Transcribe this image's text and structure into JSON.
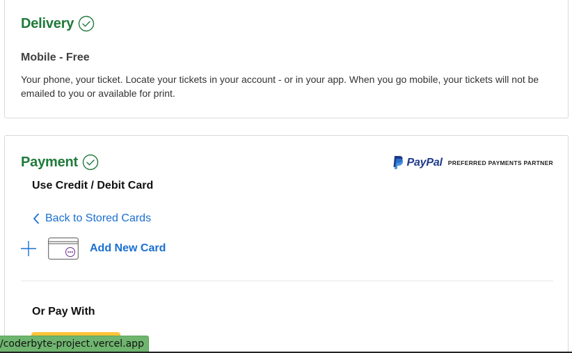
{
  "delivery": {
    "title": "Delivery",
    "method_title": "Mobile - Free",
    "description": "Your phone, your ticket. Locate your tickets in your account - or in your app. When you go mobile, your tickets will not be emailed to you or available for print."
  },
  "payment": {
    "title": "Payment",
    "paypal_word": "PayPal",
    "paypal_tagline": "PREFERRED PAYMENTS PARTNER",
    "use_card_label": "Use Credit / Debit Card",
    "back_link": "Back to Stored Cards",
    "add_card_label": "Add New Card",
    "or_pay_with": "Or Pay With"
  },
  "status_bar": {
    "url": "/coderbyte-project.vercel.app"
  },
  "colors": {
    "success_green": "#1f7a3a",
    "link_blue": "#1a6fd1",
    "paypal_yellow": "#ffc439",
    "paypal_navy": "#1f3a8a",
    "status_green": "#6fb56f"
  },
  "icons": {
    "delivery_status": "check-circle-icon",
    "payment_status": "check-circle-icon",
    "back": "chevron-left-icon",
    "add": "plus-icon",
    "card": "credit-card-icon",
    "paypal_brand": "paypal-logo-icon"
  }
}
